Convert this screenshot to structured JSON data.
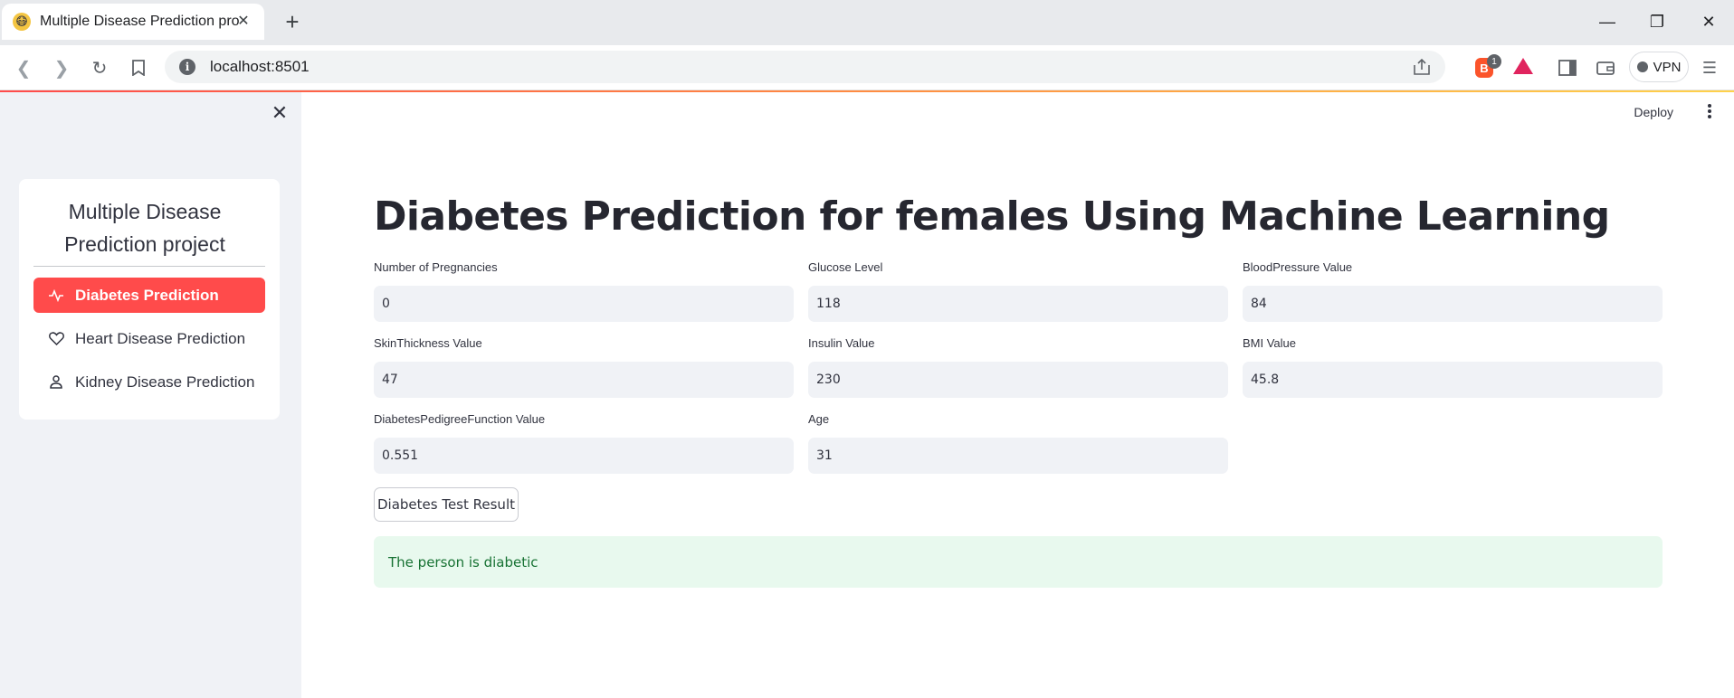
{
  "browser": {
    "tab_title": "Multiple Disease Prediction proj",
    "favicon": "😷",
    "url": "localhost:8501",
    "brave_badge_count": "1",
    "vpn_label": "VPN",
    "colors": {
      "accent": "#ff4b4b",
      "tabstrip": "#e8eaed"
    }
  },
  "sidebar": {
    "menu_title": "Multiple Disease Prediction project",
    "items": [
      {
        "label": "Diabetes Prediction",
        "icon": "activity-icon",
        "selected": true
      },
      {
        "label": "Heart Disease Prediction",
        "icon": "heart-icon",
        "selected": false
      },
      {
        "label": "Kidney Disease Prediction",
        "icon": "person-icon",
        "selected": false
      }
    ]
  },
  "header": {
    "deploy_label": "Deploy"
  },
  "main": {
    "title": "Diabetes Prediction for females Using Machine Learning",
    "fields": [
      {
        "label": "Number of Pregnancies",
        "value": "0"
      },
      {
        "label": "Glucose Level",
        "value": "118"
      },
      {
        "label": "BloodPressure Value",
        "value": "84"
      },
      {
        "label": "SkinThickness Value",
        "value": "47"
      },
      {
        "label": "Insulin Value",
        "value": "230"
      },
      {
        "label": "BMI Value",
        "value": "45.8"
      },
      {
        "label": "DiabetesPedigreeFunction Value",
        "value": "0.551"
      },
      {
        "label": "Age",
        "value": "31"
      }
    ],
    "button_label": "Diabetes Test Result",
    "result_text": "The person is diabetic",
    "result_color": "#e8f9ee"
  }
}
